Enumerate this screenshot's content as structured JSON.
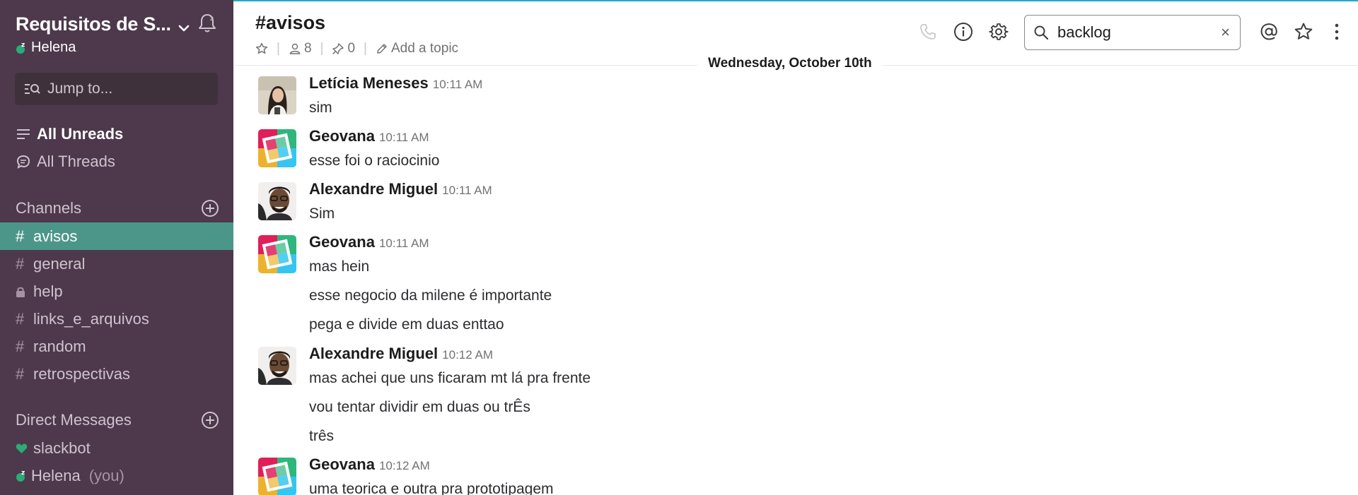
{
  "team": {
    "name": "Requisitos de S...",
    "user": "Helena"
  },
  "sidebar": {
    "jump_placeholder": "Jump to...",
    "all_unreads": "All Unreads",
    "all_threads": "All Threads",
    "channels_title": "Channels",
    "channels": [
      {
        "name": "avisos",
        "type": "public",
        "active": true
      },
      {
        "name": "general",
        "type": "public"
      },
      {
        "name": "help",
        "type": "private"
      },
      {
        "name": "links_e_arquivos",
        "type": "public"
      },
      {
        "name": "random",
        "type": "public"
      },
      {
        "name": "retrospectivas",
        "type": "public"
      }
    ],
    "dm_title": "Direct Messages",
    "dms": [
      {
        "name": "slackbot",
        "suffix": ""
      },
      {
        "name": "Helena",
        "suffix": "(you)"
      }
    ]
  },
  "channel": {
    "title": "#avisos",
    "members": "8",
    "pins": "0",
    "topic": "Add a topic",
    "date_divider": "Wednesday, October 10th"
  },
  "search": {
    "value": "backlog",
    "clear": "×"
  },
  "messages": [
    {
      "author": "Letícia Meneses",
      "time": "10:11 AM",
      "avatar": "photo-woman",
      "lines": [
        "sim"
      ]
    },
    {
      "author": "Geovana",
      "time": "10:11 AM",
      "avatar": "slack-logo",
      "lines": [
        "esse foi o raciocinio"
      ]
    },
    {
      "author": "Alexandre Miguel",
      "time": "10:11 AM",
      "avatar": "photo-man",
      "lines": [
        "Sim"
      ]
    },
    {
      "author": "Geovana",
      "time": "10:11 AM",
      "avatar": "slack-logo",
      "lines": [
        "mas hein",
        "esse negocio da milene é importante",
        "pega e divide em duas enttao"
      ]
    },
    {
      "author": "Alexandre Miguel",
      "time": "10:12 AM",
      "avatar": "photo-man",
      "lines": [
        "mas achei que uns ficaram mt lá pra frente",
        "vou tentar dividir em duas ou trÊs",
        "três"
      ]
    },
    {
      "author": "Geovana",
      "time": "10:12 AM",
      "avatar": "slack-logo",
      "lines": [
        "uma teorica e outra pra prototipagem"
      ]
    }
  ],
  "colors": {
    "sidebar_bg": "#4d394b",
    "active_channel": "#4c9689",
    "jump_bg": "#3e313c",
    "presence": "#2bac76",
    "top_accent": "#2ba6c9"
  }
}
